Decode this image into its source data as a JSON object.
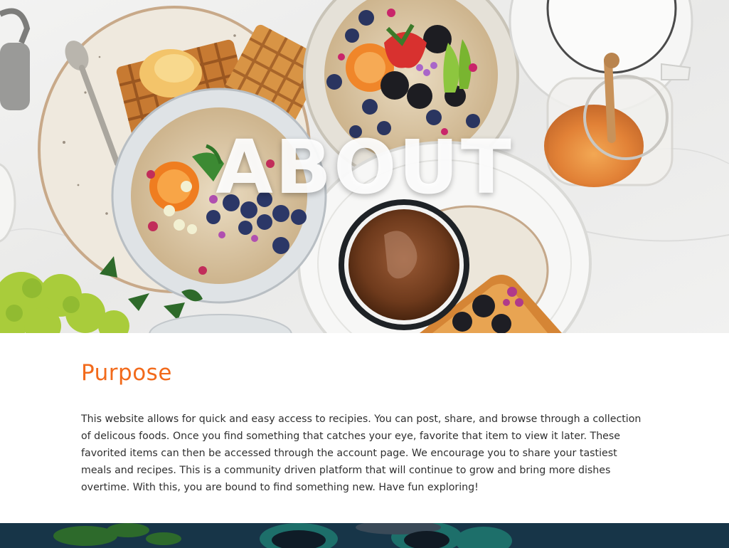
{
  "hero": {
    "title": "ABOUT"
  },
  "purpose": {
    "heading": "Purpose",
    "body": "This website allows for quick and easy access to recipies. You can post, share, and browse through a collection of delicous foods. Once you find something that catches your eye, favorite that item to view it later. These favorited items can then be accessed through the account page. We encourage you to share your tastiest meals and recipes. This is a community driven platform that will continue to grow and bring more dishes overtime. With this, you are bound to find something new. Have fun exploring!"
  },
  "colors": {
    "accent": "#f26a1b",
    "text": "#2f2f2f",
    "footer_band": "#173548"
  }
}
